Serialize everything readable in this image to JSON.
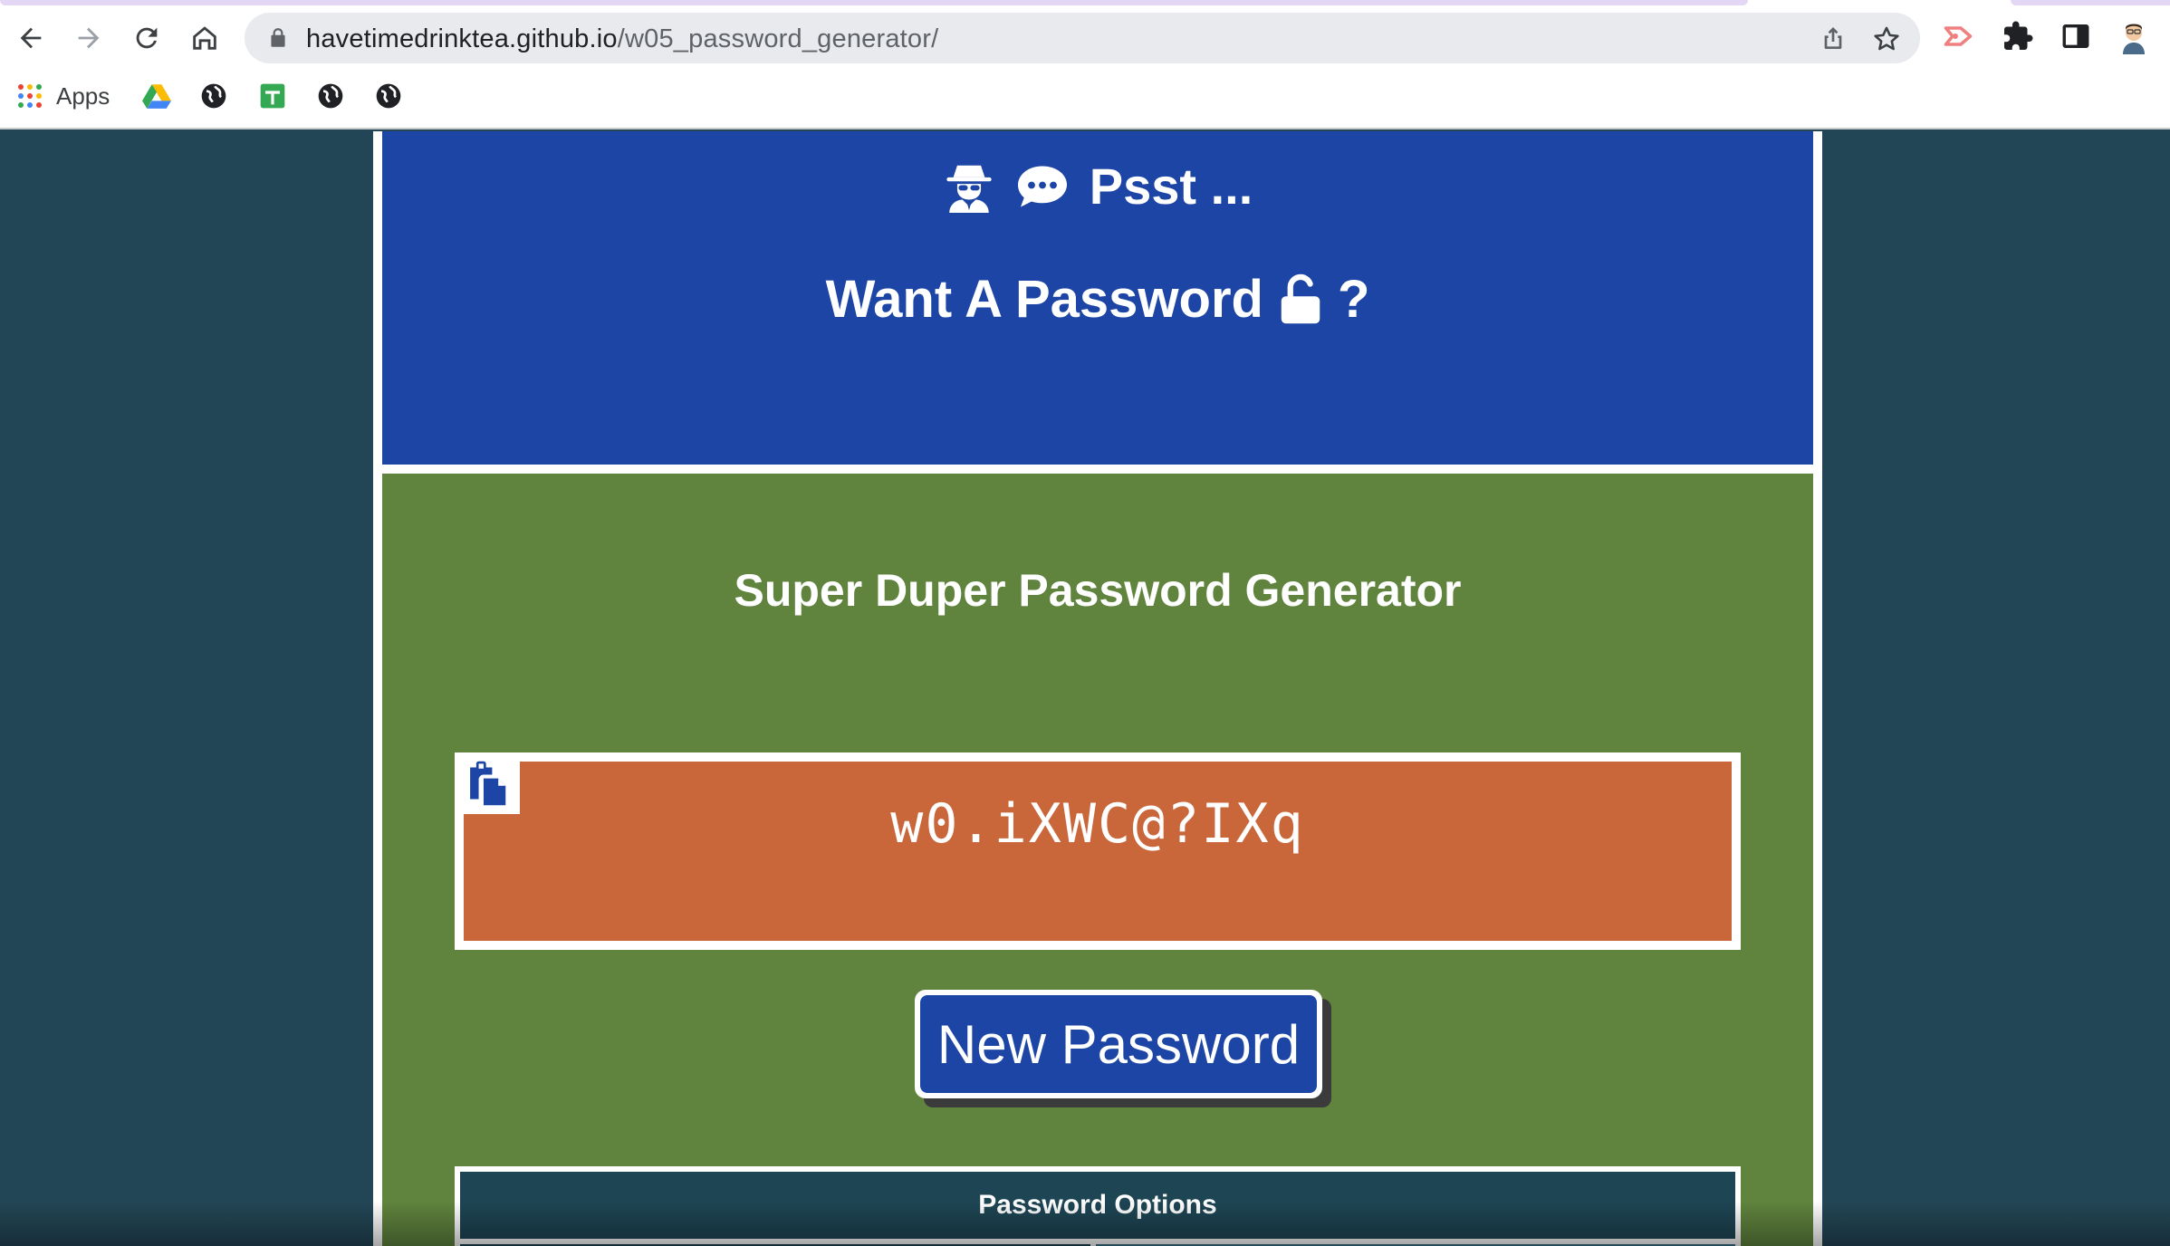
{
  "browser": {
    "url_host": "havetimedrinktea.github.io",
    "url_path": "/w05_password_generator/",
    "bookmarks": [
      {
        "label": "Apps",
        "icon": "apps-grid-icon"
      },
      {
        "label": "",
        "icon": "google-drive-icon"
      },
      {
        "label": "",
        "icon": "globe-icon"
      },
      {
        "label": "",
        "icon": "google-sheets-icon"
      },
      {
        "label": "",
        "icon": "globe-icon"
      },
      {
        "label": "",
        "icon": "globe-icon"
      }
    ]
  },
  "banner": {
    "line1": "Psst ...",
    "line2": "Want A Password",
    "line2_suffix": "?"
  },
  "generator": {
    "title": "Super Duper Password Generator",
    "password": "w0.iXWC@?IXq",
    "new_button_label": "New Password",
    "options_header": "Password Options"
  },
  "colors": {
    "page_bg": "#234656",
    "banner_bg": "#1c45a6",
    "card_bg": "#60843e",
    "password_bg": "#c9673a",
    "button_bg": "#1c45a6",
    "options_bg": "#1e4554"
  }
}
